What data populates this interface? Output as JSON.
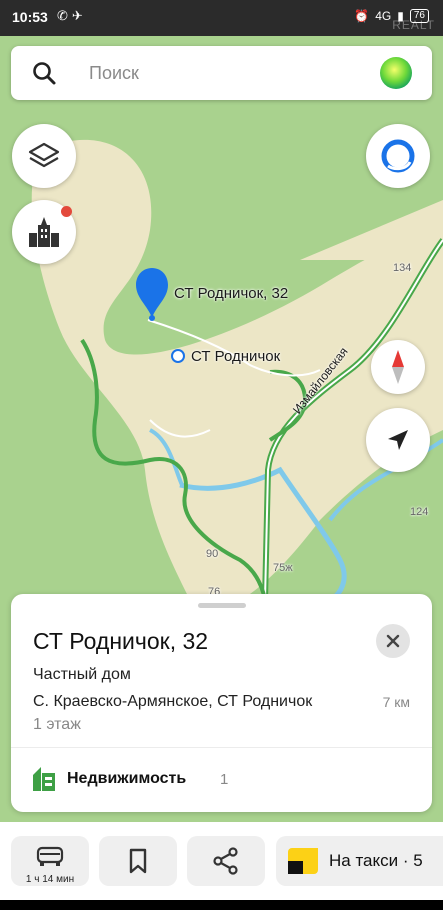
{
  "status_bar": {
    "time": "10:53",
    "battery": "76",
    "network": "4G",
    "watermark": "REALT"
  },
  "search": {
    "placeholder": "Поиск"
  },
  "map": {
    "pin_label": "СТ Родничок, 32",
    "area_label": "СТ Родничок",
    "road_label": "Измайловская",
    "house_numbers": [
      "134",
      "124",
      "90",
      "75ж",
      "76"
    ]
  },
  "card": {
    "title": "СТ Родничок, 32",
    "type": "Частный дом",
    "address": "С. Краевско-Армянское, СТ Родничок",
    "distance": "7 км",
    "floor": "1 этаж",
    "category_label": "Недвижимость",
    "category_count": "1"
  },
  "bottom_bar": {
    "route_time": "1 ч 14 мин",
    "taxi_label": "На такси · 5"
  },
  "colors": {
    "forest": "#a9d28e",
    "settlement": "#ece6c6",
    "road_green": "#49a84a",
    "river": "#7fc9ea",
    "pin_blue": "#1a73e8",
    "real_estate_green": "#3ea045"
  }
}
